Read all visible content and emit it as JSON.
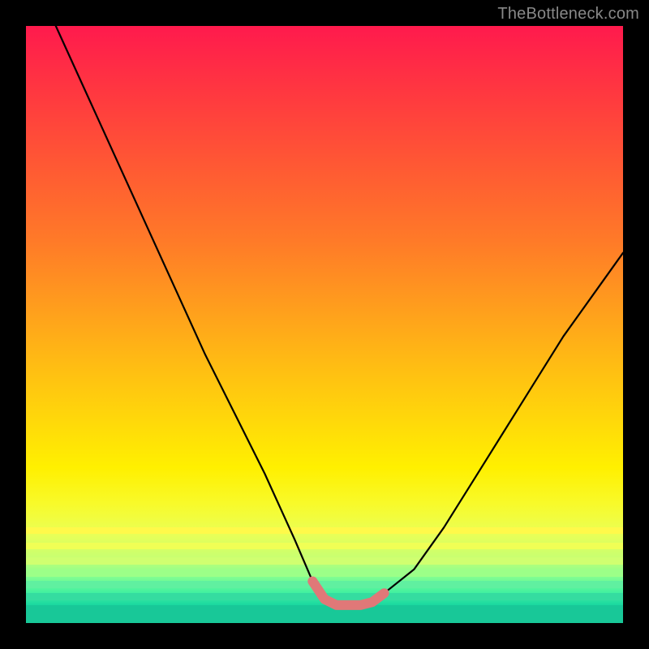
{
  "watermark": "TheBottleneck.com",
  "chart_data": {
    "type": "line",
    "title": "",
    "xlabel": "",
    "ylabel": "",
    "xlim": [
      0,
      100
    ],
    "ylim": [
      0,
      100
    ],
    "grid": false,
    "legend": false,
    "series": [
      {
        "name": "bottleneck-curve",
        "x": [
          5,
          10,
          15,
          20,
          25,
          30,
          35,
          40,
          45,
          48,
          50,
          52,
          54,
          56,
          58,
          60,
          65,
          70,
          75,
          80,
          85,
          90,
          95,
          100
        ],
        "y": [
          100,
          89,
          78,
          67,
          56,
          45,
          35,
          25,
          14,
          7,
          4,
          3,
          3,
          3,
          3.5,
          5,
          9,
          16,
          24,
          32,
          40,
          48,
          55,
          62
        ]
      }
    ],
    "valley_highlight": {
      "name": "optimal-zone",
      "color": "#e07878",
      "x": [
        48,
        50,
        52,
        54,
        56,
        58,
        60
      ],
      "y": [
        7,
        4,
        3,
        3,
        3,
        3.5,
        5
      ]
    },
    "background_gradient": {
      "top": "#ff1a4d",
      "bottom": "#0cc090",
      "stops": [
        "red",
        "orange",
        "yellow",
        "yellow-green",
        "green"
      ]
    },
    "bottom_bands": [
      {
        "y_top": 84.0,
        "height": 1.0,
        "color": "#fff94a"
      },
      {
        "y_top": 86.5,
        "height": 1.2,
        "color": "#f0ff55"
      },
      {
        "y_top": 89.0,
        "height": 1.2,
        "color": "#d0ff70"
      },
      {
        "y_top": 91.0,
        "height": 1.2,
        "color": "#9cff88"
      },
      {
        "y_top": 93.0,
        "height": 1.2,
        "color": "#60f0a0"
      },
      {
        "y_top": 95.0,
        "height": 1.2,
        "color": "#35dca0"
      },
      {
        "y_top": 97.0,
        "height": 3.0,
        "color": "#18c898"
      }
    ]
  }
}
